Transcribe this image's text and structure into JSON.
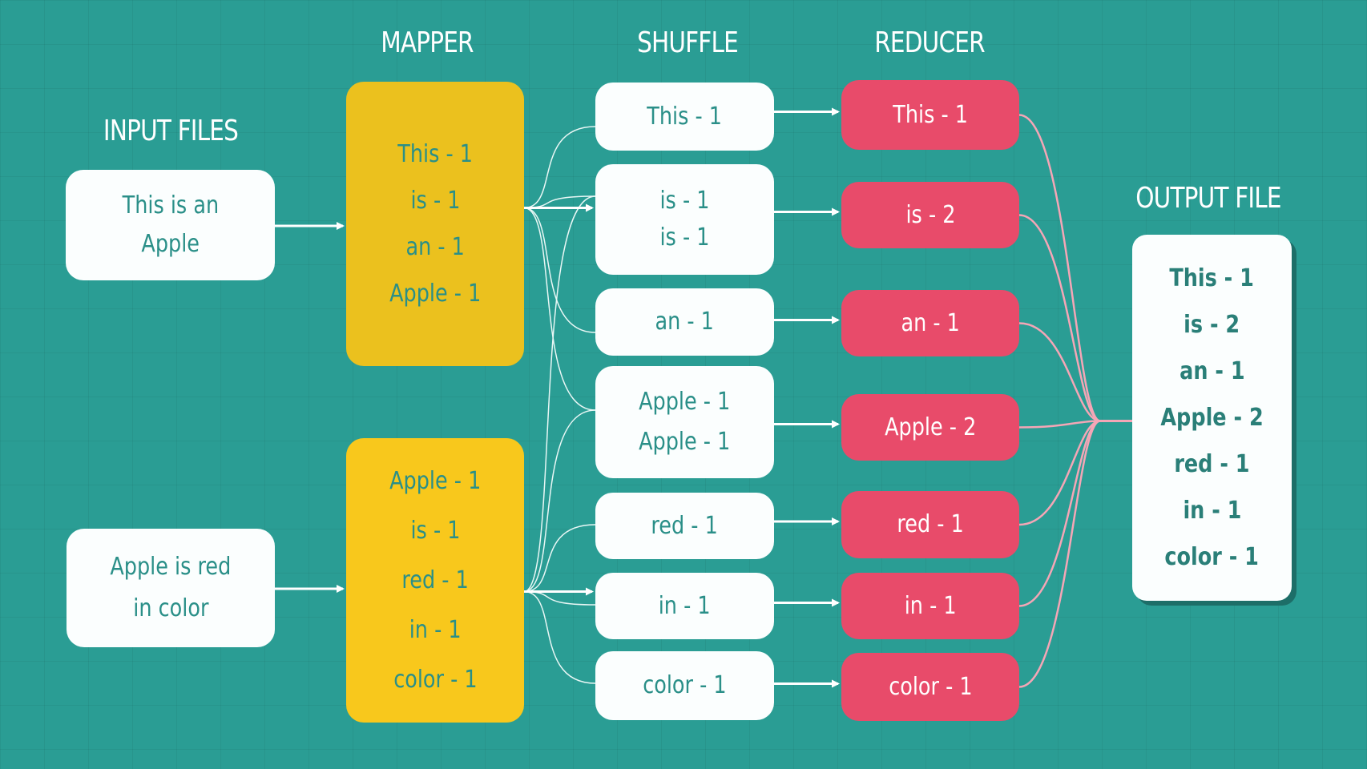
{
  "titles": {
    "input": "INPUT FILES",
    "mapper": "MAPPER",
    "shuffle": "SHUFFLE",
    "reducer": "REDUCER",
    "output": "OUTPUT FILE"
  },
  "inputs": [
    {
      "lines": [
        "This is an",
        "Apple"
      ]
    },
    {
      "lines": [
        "Apple is red",
        "in color"
      ]
    }
  ],
  "mappers": [
    {
      "lines": [
        "This - 1",
        "is - 1",
        "an - 1",
        "Apple - 1"
      ]
    },
    {
      "lines": [
        "Apple - 1",
        "is - 1",
        "red - 1",
        "in - 1",
        "color - 1"
      ]
    }
  ],
  "shuffle": [
    {
      "lines": [
        "This - 1"
      ]
    },
    {
      "lines": [
        "is - 1",
        "is - 1"
      ]
    },
    {
      "lines": [
        "an - 1"
      ]
    },
    {
      "lines": [
        "Apple - 1",
        "Apple - 1"
      ]
    },
    {
      "lines": [
        "red - 1"
      ]
    },
    {
      "lines": [
        "in - 1"
      ]
    },
    {
      "lines": [
        "color - 1"
      ]
    }
  ],
  "reducers": [
    {
      "lines": [
        "This - 1"
      ]
    },
    {
      "lines": [
        "is - 2"
      ]
    },
    {
      "lines": [
        "an - 1"
      ]
    },
    {
      "lines": [
        "Apple - 2"
      ]
    },
    {
      "lines": [
        "red - 1"
      ]
    },
    {
      "lines": [
        "in - 1"
      ]
    },
    {
      "lines": [
        "color - 1"
      ]
    }
  ],
  "output": {
    "lines": [
      "This - 1",
      "is - 2",
      "an - 1",
      "Apple - 2",
      "red - 1",
      "in - 1",
      "color - 1"
    ]
  },
  "colors": {
    "background": "#2a9d94",
    "mapper": "#ebc11e",
    "reducer": "#e84b6a",
    "text": "#2a8f88",
    "shuffle_wire": "#e8f7f5",
    "reduce_wire": "#f4a6b6"
  }
}
